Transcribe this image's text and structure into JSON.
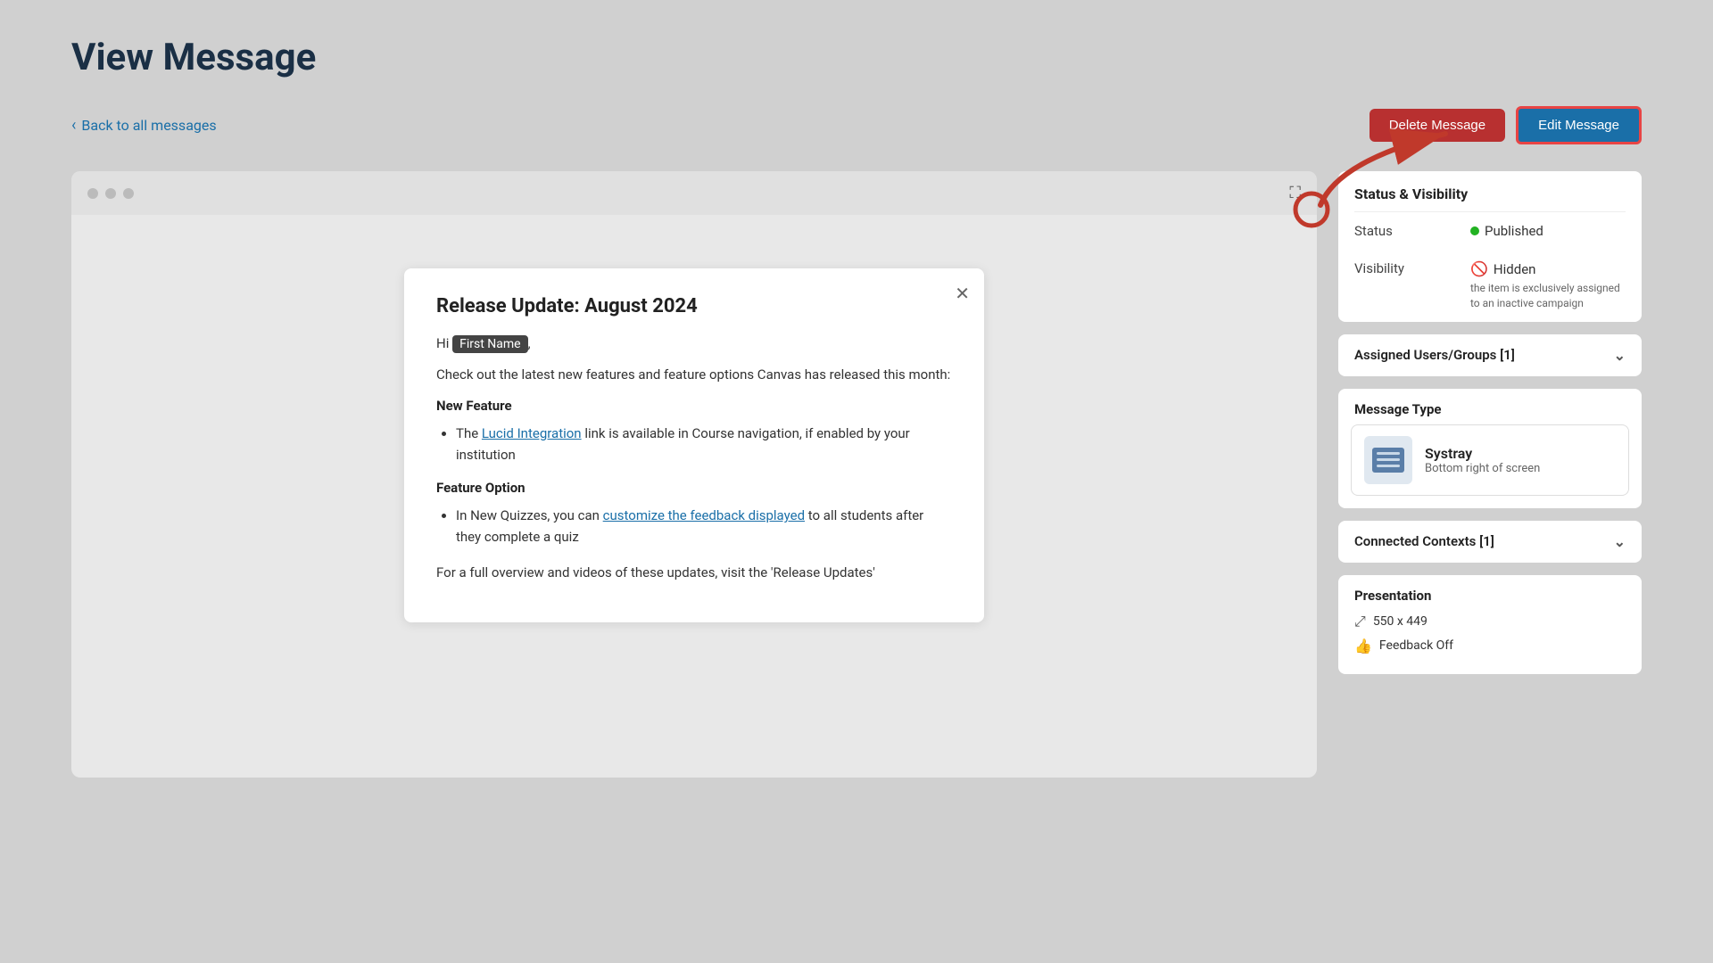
{
  "page": {
    "title": "View Message",
    "back_label": "Back to all messages"
  },
  "actions": {
    "delete_label": "Delete Message",
    "edit_label": "Edit Message"
  },
  "preview": {
    "dots": [
      "dot1",
      "dot2",
      "dot3"
    ]
  },
  "message_card": {
    "title": "Release Update: August 2024",
    "greeting": "Hi",
    "first_name": "First Name",
    "greeting_suffix": ",",
    "body_intro": "Check out the latest new features and feature options Canvas has released this month:",
    "section1_heading": "New Feature",
    "bullet1_text_before": "The ",
    "bullet1_link": "Lucid Integration",
    "bullet1_text_after": " link is available in Course navigation, if enabled by your institution",
    "section2_heading": "Feature Option",
    "bullet2_text_before": "In New Quizzes, you can ",
    "bullet2_link": "customize the feedback displayed",
    "bullet2_text_after": " to all students after they complete a quiz",
    "body_closing": "For a full overview and videos of these updates, visit the 'Release Updates'"
  },
  "sidebar": {
    "status_visibility_title": "Status & Visibility",
    "status_label": "Status",
    "status_value": "Published",
    "visibility_label": "Visibility",
    "visibility_value": "Hidden",
    "visibility_note": "the item is exclusively assigned to an inactive campaign",
    "assigned_label": "Assigned Users/Groups [1]",
    "message_type_label": "Message Type",
    "systray_name": "Systray",
    "systray_desc": "Bottom right of screen",
    "connected_contexts_label": "Connected Contexts [1]",
    "presentation_label": "Presentation",
    "dimensions": "550 x 449",
    "feedback_label": "Feedback Off"
  }
}
